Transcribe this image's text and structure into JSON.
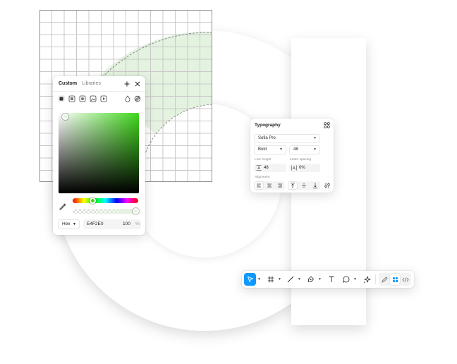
{
  "colors": {
    "accent": "#0d99ff",
    "picked": "#E4F2E0",
    "hue": "#3fd81a",
    "grid_fill": "#e4f2e0"
  },
  "color_picker": {
    "tabs": [
      {
        "label": "Custom",
        "active": true
      },
      {
        "label": "Libraries",
        "active": false
      }
    ],
    "header_icons": [
      "plus-icon",
      "close-icon"
    ],
    "fill_types": [
      "solid-fill-icon",
      "linear-gradient-icon",
      "radial-gradient-icon",
      "image-fill-icon",
      "video-fill-icon"
    ],
    "extra_icons": [
      "blend-mode-icon",
      "hidden-toggle-icon"
    ],
    "format": "Hex",
    "hex": "E4F2E0",
    "opacity": "100",
    "opacity_unit": "%",
    "hue_level": 0.33,
    "alpha_level": 1.0
  },
  "typography": {
    "title": "Typography",
    "font_family": "Sofia Pro",
    "font_weight": "Bold",
    "font_size": "48",
    "line_height_label": "Line height",
    "line_height": "48",
    "letter_spacing_label": "Letter spacing",
    "letter_spacing": "0%",
    "alignment_label": "Alignment",
    "horizontal_align": [
      "align-left-icon",
      "align-center-icon",
      "align-right-icon"
    ],
    "vertical_align": [
      "align-top-icon",
      "align-middle-icon",
      "align-bottom-icon"
    ],
    "selected_horizontal": "align-left",
    "selected_vertical": "align-top"
  },
  "toolbar": {
    "tools": [
      {
        "name": "move-tool",
        "icon": "cursor-icon",
        "selected": true,
        "caret": true
      },
      {
        "name": "frame-tool",
        "icon": "frame-hash-icon",
        "selected": false,
        "caret": true
      },
      {
        "name": "pen-line-tool",
        "icon": "line-icon",
        "selected": false,
        "caret": true
      },
      {
        "name": "pen-tool",
        "icon": "pen-nib-icon",
        "selected": false,
        "caret": true
      },
      {
        "name": "text-tool",
        "icon": "text-icon",
        "selected": false,
        "caret": false
      },
      {
        "name": "comment-tool",
        "icon": "comment-bubble-icon",
        "selected": false,
        "caret": true
      },
      {
        "name": "actions-tool",
        "icon": "sparkle-actions-icon",
        "selected": false,
        "caret": false
      }
    ],
    "modes": [
      {
        "name": "draw-mode",
        "icon": "pencil-mode-icon",
        "selected": false
      },
      {
        "name": "design-mode",
        "icon": "design-mode-icon",
        "selected": true
      },
      {
        "name": "dev-mode",
        "icon": "code-icon",
        "selected": false
      }
    ]
  }
}
